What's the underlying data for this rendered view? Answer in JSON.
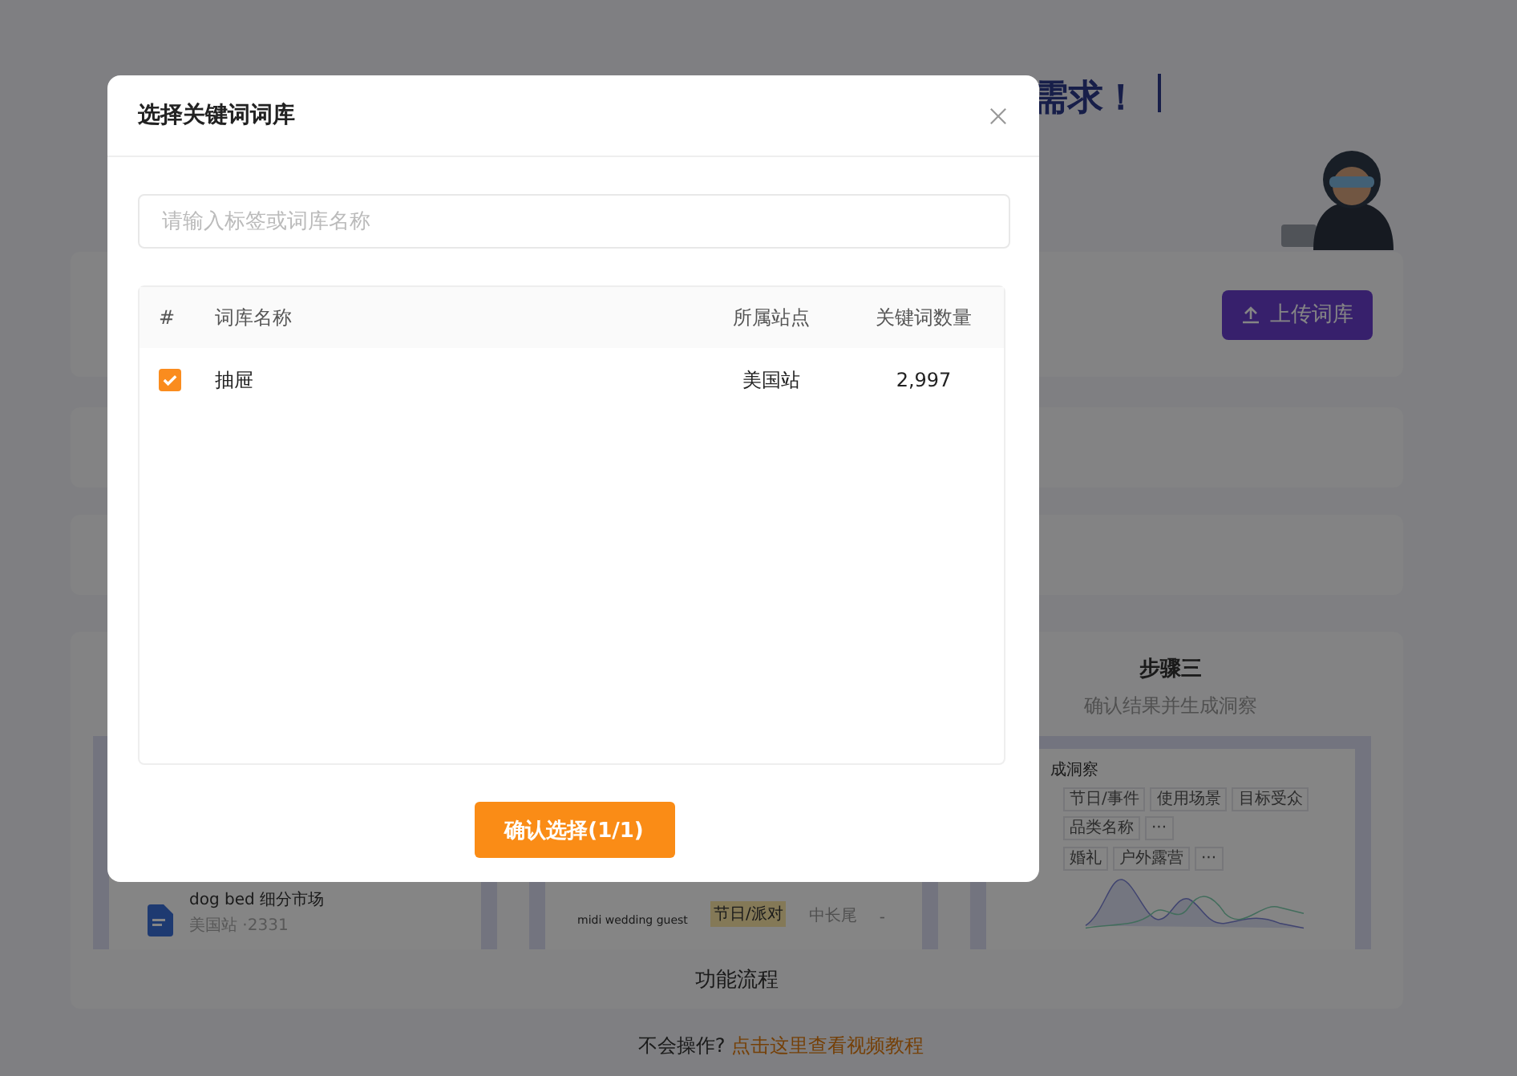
{
  "background": {
    "heading": "需求！",
    "upload_button": "上传词库",
    "step_one_preview": {
      "file_name": "dog bed 细分市场",
      "file_meta": "美国站 ·2331"
    },
    "step_two_preview": {
      "keyword": "midi wedding guest",
      "tag": "节日/派对",
      "level": "中长尾",
      "dash": "-"
    },
    "step_three": {
      "title": "步骤三",
      "subtitle": "确认结果并生成洞察",
      "preview_title": "成洞察",
      "tag_rows": [
        [
          "节日/事件",
          "使用场景",
          "目标受众",
          "品类名称",
          "···"
        ],
        [
          "婚礼",
          "户外露营",
          "···"
        ]
      ]
    },
    "section_title": "功能流程",
    "help": {
      "prefix": "不会操作?",
      "link": "点击这里查看视频教程"
    }
  },
  "dialog": {
    "title": "选择关键词词库",
    "search": {
      "placeholder": "请输入标签或词库名称"
    },
    "columns": [
      "#",
      "词库名称",
      "所属站点",
      "关键词数量"
    ],
    "rows": [
      {
        "checked": true,
        "name": "抽屉",
        "site": "美国站",
        "count": "2,997"
      }
    ],
    "confirm_button": "确认选择(1/1)"
  }
}
